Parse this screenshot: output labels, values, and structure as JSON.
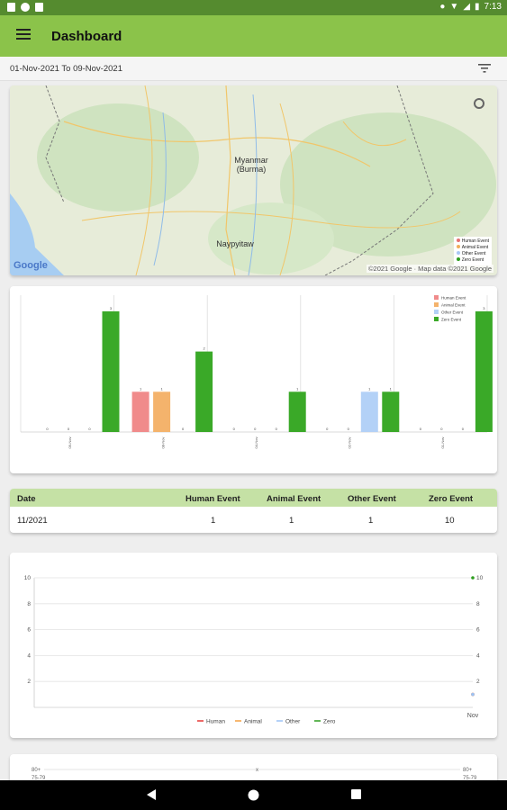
{
  "status": {
    "time": "7:13"
  },
  "appbar": {
    "title": "Dashboard"
  },
  "filter": {
    "range": "01-Nov-2021 To 09-Nov-2021"
  },
  "map": {
    "region_label_1": "Myanmar",
    "region_label_2": "(Burma)",
    "city": "Naypyitaw",
    "google": "Google",
    "credit": "©2021 Google · Map data ©2021 Google",
    "legend": [
      {
        "label": "Human Event",
        "color": "#e57373"
      },
      {
        "label": "Animal Event",
        "color": "#f0ad5a"
      },
      {
        "label": "Other Event",
        "color": "#a9c8f5"
      },
      {
        "label": "Zero Event",
        "color": "#2e9e1f"
      }
    ]
  },
  "colors": {
    "human": "#f08b8b",
    "animal": "#f4b36c",
    "other": "#b3d1f7",
    "zero": "#3aa928",
    "accent": "#8bc34a"
  },
  "chart_data": [
    {
      "type": "bar",
      "categories": [
        "09-Nov",
        "08-Nov",
        "04-Nov",
        "02-Nov",
        "01-Nov"
      ],
      "series": [
        {
          "name": "Human Event",
          "values": [
            0,
            1,
            0,
            0,
            0
          ]
        },
        {
          "name": "Animal Event",
          "values": [
            0,
            1,
            0,
            0,
            0
          ]
        },
        {
          "name": "Other Event",
          "values": [
            0,
            0,
            0,
            1,
            0
          ]
        },
        {
          "name": "Zero Event",
          "values": [
            3,
            2,
            1,
            1,
            3
          ]
        }
      ],
      "ylim": [
        0,
        3.4
      ],
      "legend": "top-right"
    },
    {
      "type": "line",
      "categories": [
        "Nov"
      ],
      "series": [
        {
          "name": "Human",
          "values": [
            1
          ]
        },
        {
          "name": "Animal",
          "values": [
            1
          ]
        },
        {
          "name": "Other",
          "values": [
            1
          ]
        },
        {
          "name": "Zero",
          "values": [
            10
          ]
        }
      ],
      "yticks": [
        "2",
        "4",
        "6",
        "8",
        "10"
      ],
      "ylim": [
        0,
        10
      ],
      "legend": "bottom"
    }
  ],
  "table": {
    "headers": [
      "Date",
      "Human Event",
      "Animal Event",
      "Other Event",
      "Zero Event"
    ],
    "rows": [
      [
        "11/2021",
        "1",
        "1",
        "1",
        "10"
      ]
    ]
  },
  "bottom_chart": {
    "tick_top": "80+",
    "tick_sub": "75-79",
    "mid": "x"
  }
}
